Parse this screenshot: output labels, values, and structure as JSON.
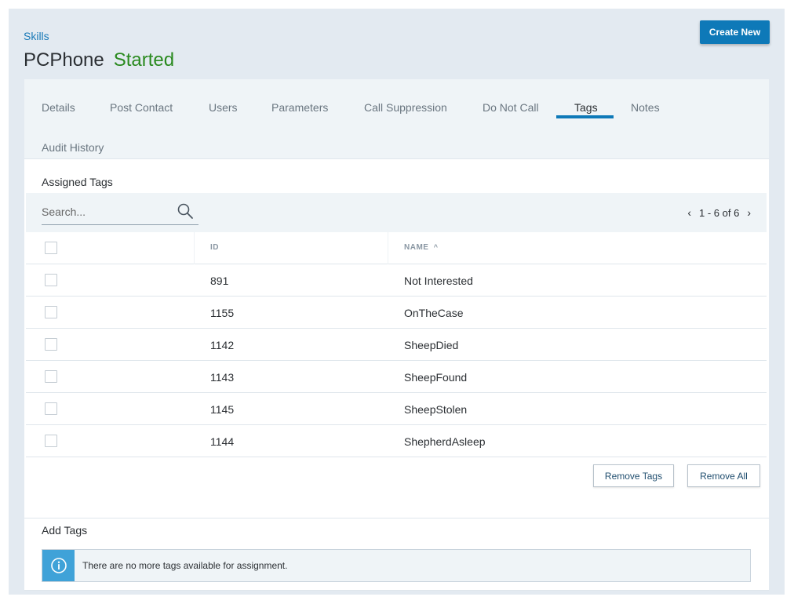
{
  "breadcrumb": "Skills",
  "page": {
    "title": "PCPhone",
    "status": "Started",
    "status_color": "#2a8a1f"
  },
  "actions": {
    "create_new": "Create New"
  },
  "tabs": [
    {
      "label": "Details",
      "active": false
    },
    {
      "label": "Post Contact",
      "active": false
    },
    {
      "label": "Users",
      "active": false
    },
    {
      "label": "Parameters",
      "active": false
    },
    {
      "label": "Call Suppression",
      "active": false
    },
    {
      "label": "Do Not Call",
      "active": false
    },
    {
      "label": "Tags",
      "active": true
    },
    {
      "label": "Notes",
      "active": false
    },
    {
      "label": "Audit History",
      "active": false
    }
  ],
  "assigned": {
    "title": "Assigned Tags",
    "search": {
      "placeholder": "Search...",
      "value": ""
    },
    "pager": {
      "range": "1 - 6 of 6"
    },
    "columns": {
      "id": "ID",
      "name": "NAME"
    },
    "sort_indicator": "^",
    "rows": [
      {
        "id": "891",
        "name": "Not Interested"
      },
      {
        "id": "1155",
        "name": "OnTheCase"
      },
      {
        "id": "1142",
        "name": "SheepDied"
      },
      {
        "id": "1143",
        "name": "SheepFound"
      },
      {
        "id": "1145",
        "name": "SheepStolen"
      },
      {
        "id": "1144",
        "name": "ShepherdAsleep"
      }
    ],
    "remove_tags": "Remove Tags",
    "remove_all": "Remove All"
  },
  "add": {
    "title": "Add Tags",
    "message": "There are no more tags available for assignment."
  },
  "colors": {
    "accent": "#0e79b8",
    "info": "#3fa2d8",
    "link": "#1a7ab8"
  },
  "icons": {
    "search": "search-icon",
    "info": "info-icon",
    "prev": "chevron-left-icon",
    "next": "chevron-right-icon"
  }
}
